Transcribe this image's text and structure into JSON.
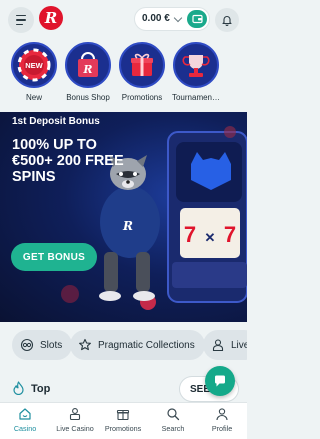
{
  "header": {
    "menu_icon": "hamburger-icon",
    "logo_letter": "R",
    "balance": "0.00 €",
    "wallet_icon": "wallet-icon",
    "bell_icon": "bell-icon"
  },
  "categories": [
    {
      "label": "New",
      "badge": "NEW",
      "icon": "new-chip-icon"
    },
    {
      "label": "Bonus Shop",
      "icon": "shopping-bag-icon"
    },
    {
      "label": "Promotions",
      "icon": "gift-icon"
    },
    {
      "label": "Tournamen…",
      "icon": "trophy-icon"
    }
  ],
  "banner": {
    "kicker": "1st Deposit Bonus",
    "title": "100% UP TO €500+ 200 FREE SPINS",
    "cta_label": "GET BONUS"
  },
  "chips": [
    {
      "label": "Slots",
      "icon": "slots-icon"
    },
    {
      "label": "Pragmatic Collections",
      "icon": "star-icon"
    },
    {
      "label": "Live",
      "icon": "dealer-icon"
    }
  ],
  "top_section": {
    "title": "Top",
    "see_label": "SEE",
    "icon": "fire-icon"
  },
  "bottom_nav": [
    {
      "label": "Casino",
      "icon": "casino-icon",
      "active": true
    },
    {
      "label": "Live Casino",
      "icon": "live-casino-icon"
    },
    {
      "label": "Promotions",
      "icon": "gift-icon"
    },
    {
      "label": "Search",
      "icon": "search-icon"
    },
    {
      "label": "Profile",
      "icon": "profile-icon"
    }
  ],
  "colors": {
    "brand_red": "#e0142c",
    "accent_green": "#1fb391",
    "active_nav": "#1f8f9f",
    "background": "#eef3f4"
  }
}
